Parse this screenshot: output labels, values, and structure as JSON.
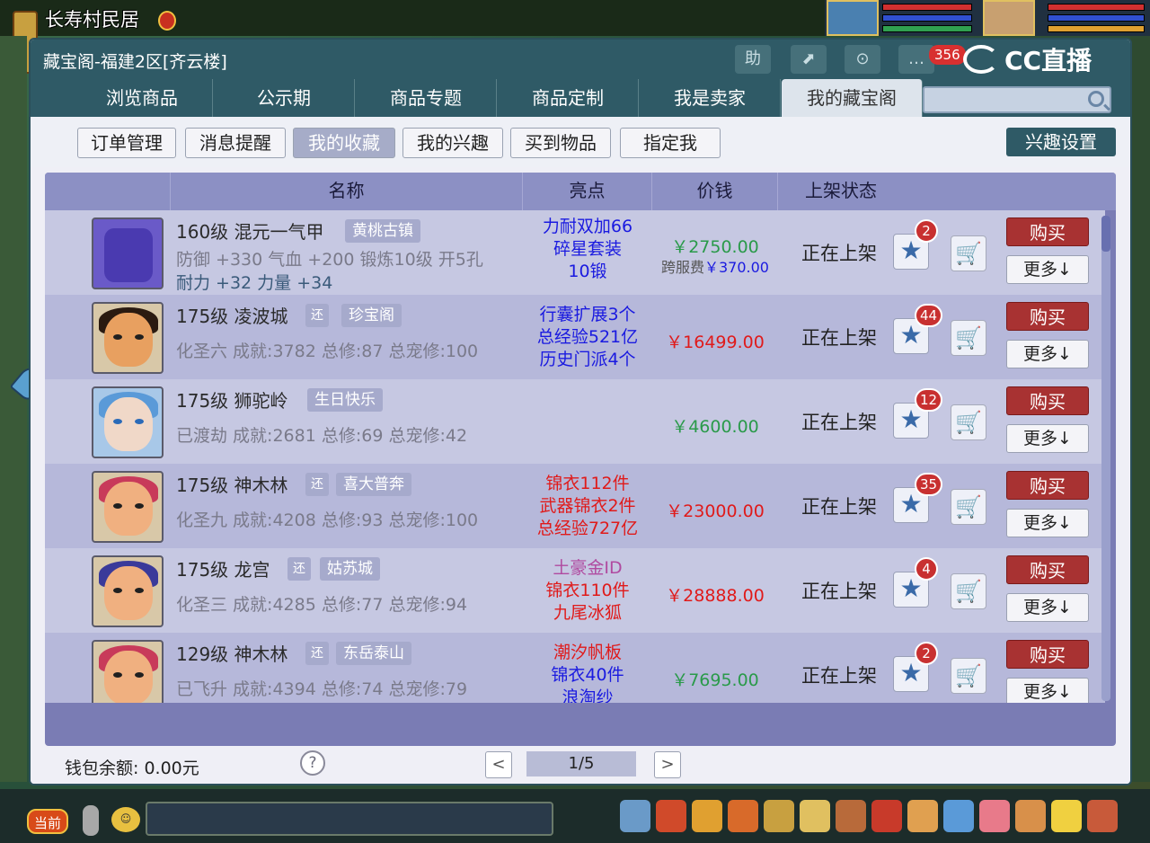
{
  "game": {
    "location": "长寿村民居"
  },
  "window": {
    "title": "藏宝阁-福建2区[齐云楼]",
    "title_buttons": [
      "助",
      "⬈",
      "⊙",
      "…"
    ],
    "notification_count": "356",
    "watermark": "CC直播"
  },
  "tabs": [
    {
      "label": "浏览商品"
    },
    {
      "label": "公示期"
    },
    {
      "label": "商品专题"
    },
    {
      "label": "商品定制"
    },
    {
      "label": "我是卖家"
    },
    {
      "label": "我的藏宝阁"
    }
  ],
  "search": {
    "placeholder": ""
  },
  "subnav": [
    {
      "label": "订单管理"
    },
    {
      "label": "消息提醒"
    },
    {
      "label": "我的收藏"
    },
    {
      "label": "我的兴趣"
    },
    {
      "label": "买到物品"
    },
    {
      "label": "指定我"
    }
  ],
  "interest_settings": "兴趣设置",
  "table": {
    "headers": [
      "名称",
      "亮点",
      "价钱",
      "上架状态"
    ],
    "rows": [
      {
        "level_name": "160级 混元一气甲",
        "tag": "黄桃古镇",
        "desc": "防御 +330 气血 +200 锻炼10级 开5孔",
        "desc2": "耐力 +32 力量 +34",
        "highlights": [
          "力耐双加66",
          "碎星套装",
          "10锻"
        ],
        "highlight_color": "#1a1ae0",
        "price": "￥2750.00",
        "price_color": "#2a9a4a",
        "fee": "跨服费",
        "fee_amount": "￥370.00",
        "status": "正在上架",
        "favorites": "2"
      },
      {
        "level_name": "175级 凌波城",
        "has_huan": true,
        "tag": "珍宝阁",
        "desc": "化圣六 成就:3782 总修:87 总宠修:100",
        "highlights": [
          "行囊扩展3个",
          "总经验521亿",
          "历史门派4个"
        ],
        "highlight_color": "#1a1ae0",
        "price": "￥16499.00",
        "price_color": "#e01a1a",
        "status": "正在上架",
        "favorites": "44"
      },
      {
        "level_name": "175级 狮驼岭",
        "tag": "生日快乐",
        "desc": "已渡劫 成就:2681 总修:69 总宠修:42",
        "highlights": [],
        "price": "￥4600.00",
        "price_color": "#2a9a4a",
        "status": "正在上架",
        "favorites": "12"
      },
      {
        "level_name": "175级 神木林",
        "has_huan": true,
        "tag": "喜大普奔",
        "desc": "化圣九 成就:4208 总修:93 总宠修:100",
        "highlights": [
          "锦衣112件",
          "武器锦衣2件",
          "总经验727亿"
        ],
        "highlight_color": "#e01a1a",
        "price": "￥23000.00",
        "price_color": "#e01a1a",
        "status": "正在上架",
        "favorites": "35"
      },
      {
        "level_name": "175级 龙宫",
        "has_huan": true,
        "tag": "姑苏城",
        "desc": "化圣三 成就:4285 总修:77 总宠修:94",
        "highlights": [
          "土豪金ID",
          "锦衣110件",
          "九尾冰狐"
        ],
        "highlight_colors": [
          "#b04aa0",
          "#e01a1a",
          "#e01a1a"
        ],
        "price": "￥28888.00",
        "price_color": "#e01a1a",
        "status": "正在上架",
        "favorites": "4"
      },
      {
        "level_name": "129级 神木林",
        "has_huan": true,
        "tag": "东岳泰山",
        "desc": "已飞升 成就:4394 总修:74 总宠修:79",
        "highlights": [
          "潮汐帆板",
          "锦衣40件",
          "浪淘纱"
        ],
        "highlight_colors": [
          "#e01a1a",
          "#1a1ae0",
          "#1a1ae0"
        ],
        "price": "￥7695.00",
        "price_color": "#2a9a4a",
        "status": "正在上架",
        "favorites": "2"
      }
    ],
    "buy_label": "购买",
    "more_label": "更多↓",
    "huan_label": "还"
  },
  "footer": {
    "wallet": "钱包余额: 0.00元",
    "help": "?",
    "page": "1/5",
    "prev": "<",
    "next": ">"
  },
  "bottombar": {
    "channel": "当前"
  },
  "colors": {
    "window_header": "#2f5a66",
    "table_header": "#8c90c4",
    "buy_button": "#a83232"
  }
}
